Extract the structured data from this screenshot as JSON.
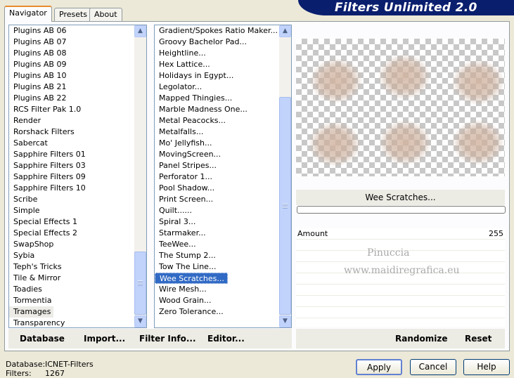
{
  "app": {
    "banner": "Filters Unlimited 2.0"
  },
  "tabs": [
    {
      "label": "Navigator",
      "active": true
    },
    {
      "label": "Presets",
      "active": false
    },
    {
      "label": "About",
      "active": false
    }
  ],
  "categories": [
    "Plugins AB 06",
    "Plugins AB 07",
    "Plugins AB 08",
    "Plugins AB 09",
    "Plugins AB 10",
    "Plugins AB 21",
    "Plugins AB 22",
    "RCS Filter Pak 1.0",
    "Render",
    "Rorshack Filters",
    "Sabercat",
    "Sapphire Filters 01",
    "Sapphire Filters 03",
    "Sapphire Filters 09",
    "Sapphire Filters 10",
    "Scribe",
    "Simple",
    "Special Effects 1",
    "Special Effects 2",
    "SwapShop",
    "Sybia",
    "Teph's Tricks",
    "Tile & Mirror",
    "Toadies",
    "Tormentia",
    "Tramages",
    "Transparency"
  ],
  "categories_selected": "Tramages",
  "filters": [
    "Gradient/Spokes Ratio Maker...",
    "Groovy Bachelor Pad...",
    "Heightline...",
    "Hex Lattice...",
    "Holidays in Egypt...",
    "Legolator...",
    "Mapped Thingies...",
    "Marble Madness One...",
    "Metal Peacocks...",
    "Metalfalls...",
    "Mo' Jellyfish...",
    "MovingScreen...",
    "Panel Stripes...",
    "Perforator 1...",
    "Pool Shadow...",
    "Print Screen...",
    "Quilt......",
    "Spiral 3...",
    "Starmaker...",
    "TeeWee...",
    "The Stump 2...",
    "Tow The Line...",
    "Wee Scratches...",
    "Wire Mesh...",
    "Wood Grain...",
    "Zero Tolerance..."
  ],
  "filters_selected": "Wee Scratches...",
  "left_actions": {
    "database": "Database",
    "import": "Import...",
    "filter_info": "Filter Info...",
    "editor": "Editor..."
  },
  "preview": {
    "filter_name": "Wee Scratches..."
  },
  "params": [
    {
      "label": "Amount",
      "value": "255"
    }
  ],
  "watermark": {
    "line1": "Pinuccia",
    "line2": "www.maidiregrafica.eu"
  },
  "right_actions": {
    "randomize": "Randomize",
    "reset": "Reset"
  },
  "status": {
    "database_label": "Database:",
    "database_value": "ICNET-Filters",
    "filters_label": "Filters:",
    "filters_value": "1267"
  },
  "buttons": {
    "apply": "Apply",
    "cancel": "Cancel",
    "help": "Help"
  }
}
